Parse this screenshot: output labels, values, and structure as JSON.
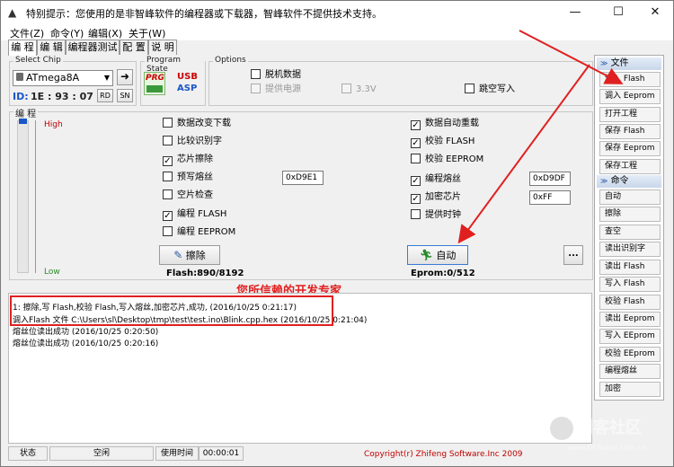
{
  "window": {
    "title": "特别提示：您使用的是非智峰软件的编程器或下载器，智峰软件不提供技术支持。",
    "controls": {
      "minimize": "—",
      "maximize": "☐",
      "close": "✕"
    }
  },
  "menu": [
    "文件(Z)",
    "命令(Y)",
    "编辑(X)",
    "关于(W)"
  ],
  "tabs": [
    "编 程",
    "编 辑",
    "编程器测试",
    "配 置",
    "说 明"
  ],
  "chip": {
    "group_label": "Select Chip",
    "selected": "ATmega8A",
    "id_label": "ID:",
    "id_value": "1E : 93 : 07",
    "rd": "RD",
    "sn": "SN"
  },
  "program_state": {
    "group_label": "Program State",
    "prg": "PRG",
    "usb": "USB",
    "asp": "ASP"
  },
  "options": {
    "group_label": "Options",
    "offline": "脱机数据",
    "power": "提供电源",
    "voltage": "3.3V",
    "jump": "跳空写入"
  },
  "program_panel": {
    "label": "编 程",
    "high": "High",
    "low": "Low",
    "left_checks": [
      {
        "label": "数据改变下载",
        "checked": false
      },
      {
        "label": "比较识别字",
        "checked": false
      },
      {
        "label": "芯片擦除",
        "checked": true
      },
      {
        "label": "预写熔丝",
        "checked": false
      },
      {
        "label": "空片检查",
        "checked": false
      },
      {
        "label": "编程 FLASH",
        "checked": true
      },
      {
        "label": "编程 EEPROM",
        "checked": false
      }
    ],
    "right_checks": [
      {
        "label": "数据自动重载",
        "checked": true
      },
      {
        "label": "校验 FLASH",
        "checked": true
      },
      {
        "label": "校验 EEPROM",
        "checked": false
      },
      {
        "label": "编程熔丝",
        "checked": true
      },
      {
        "label": "加密芯片",
        "checked": true
      },
      {
        "label": "提供时钟",
        "checked": false
      }
    ],
    "pre_fuse_value": "0xD9E1",
    "fuse_value": "0xD9DF",
    "lock_value": "0xFF",
    "erase_button": "擦除",
    "auto_button": "自动",
    "more_button": "...",
    "flash_info": "Flash:890/8192",
    "eprom_info": "Eprom:0/512",
    "slogan": "您所信赖的开发专家"
  },
  "sidebar": {
    "file_header": "文件",
    "file_buttons": [
      "调入 Flash",
      "调入 Eeprom",
      "打开工程",
      "保存 Flash",
      "保存 Eeprom",
      "保存工程"
    ],
    "cmd_header": "命令",
    "cmd_buttons": [
      "自动",
      "擦除",
      "查空",
      "读出识别字",
      "读出 Flash",
      "写入 Flash",
      "校验 Flash",
      "读出 Eeprom",
      "写入 EEprom",
      "校验 EEprom",
      "编程熔丝",
      "加密"
    ]
  },
  "log": [
    "1: 擦除,写 Flash,校验 Flash,写入熔丝,加密芯片,成功, (2016/10/25 0:21:17)",
    "调入Flash 文件 C:\\Users\\sl\\Desktop\\tmp\\test\\test.ino\\Blink.cpp.hex (2016/10/25 0:21:04)",
    "熔丝位读出成功 (2016/10/25 0:20:50)",
    "熔丝位读出成功 (2016/10/25 0:20:16)"
  ],
  "status": {
    "state_label": "状态",
    "state_value": "空闲",
    "time_label": "使用时间",
    "time_value": "00:00:01",
    "copyright": "Copyright(r) Zhifeng Software.Inc 2009"
  },
  "watermark": {
    "text": "创客社区",
    "url": "www.DFRobot.com.cn"
  },
  "colors": {
    "annotation_red": "#e02020",
    "accent_blue": "#1a56c8",
    "title_red": "#c00000"
  }
}
